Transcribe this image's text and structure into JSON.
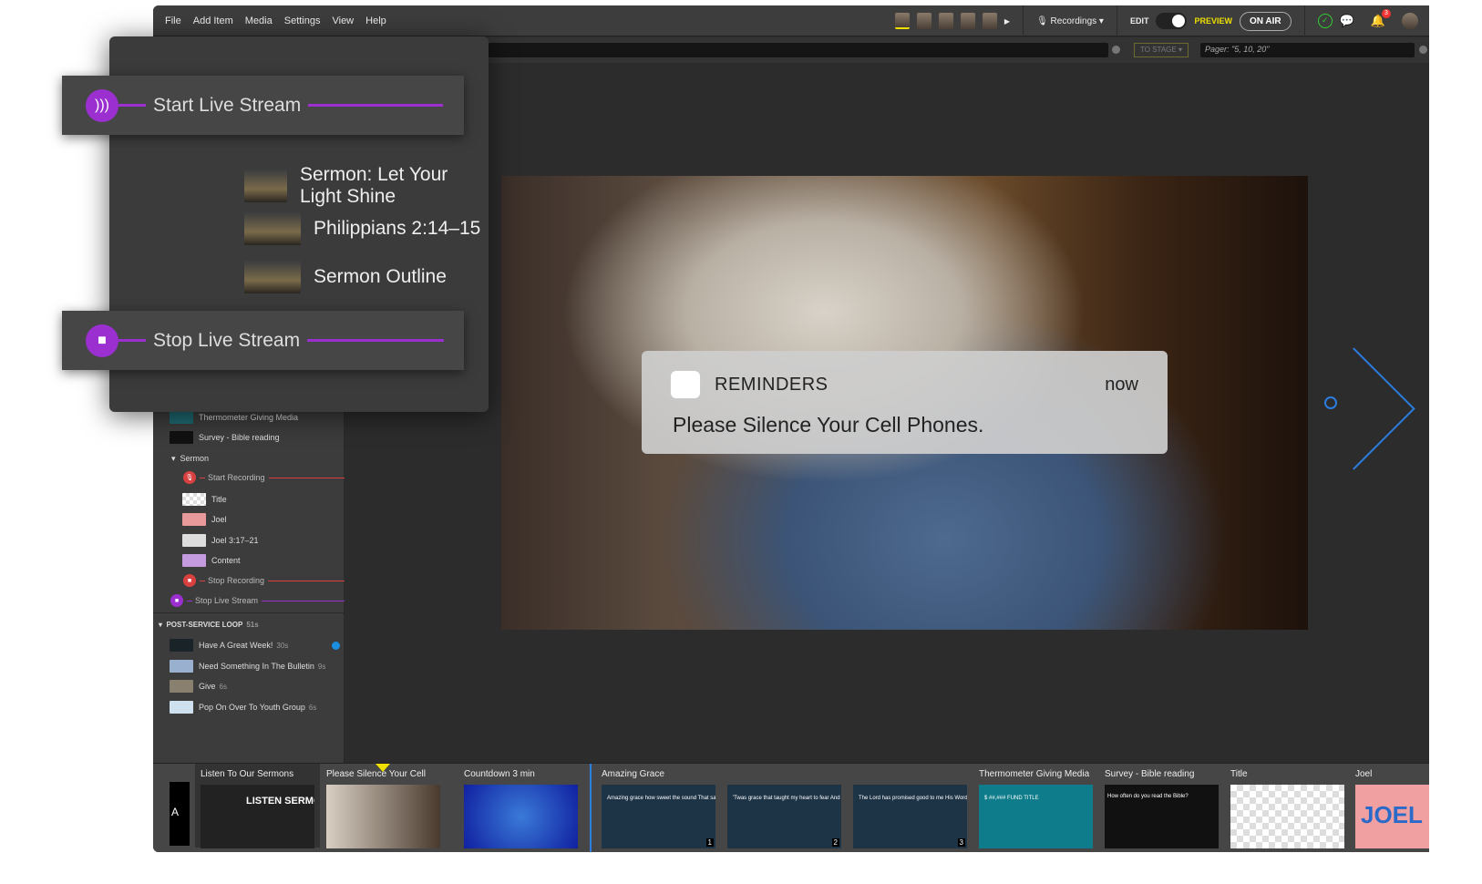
{
  "menu": [
    "File",
    "Add Item",
    "Media",
    "Settings",
    "View",
    "Help"
  ],
  "header": {
    "recordings": "Recordings",
    "edit": "EDIT",
    "preview": "PREVIEW",
    "on_air": "ON AIR",
    "notifications_count": "3",
    "accent": "#f0e000"
  },
  "toolbar": {
    "to_stage": "TO STAGE",
    "pager_placeholder": "Pager: \"5, 10, 20\""
  },
  "popup": {
    "start": "Start Live Stream",
    "stop": "Stop Live Stream",
    "items": [
      "Sermon: Let Your Light Shine",
      "Philippians 2:14–15",
      "Sermon Outline"
    ],
    "accent": "#9b2fd0"
  },
  "sidebar": {
    "items": [
      "Thermometer Giving Media",
      "Survey - Bible reading"
    ],
    "section": "Sermon",
    "start_recording": "Start Recording",
    "sermon_items": [
      "Title",
      "Joel",
      "Joel 3:17–21",
      "Content"
    ],
    "stop_recording": "Stop Recording",
    "stop_stream": "Stop Live Stream",
    "loop": {
      "title": "POST-SERVICE LOOP",
      "duration": "51s",
      "items": [
        {
          "label": "Have A Great Week!",
          "dur": "30s"
        },
        {
          "label": "Need Something In The Bulletin",
          "dur": "9s"
        },
        {
          "label": "Give",
          "dur": "6s"
        },
        {
          "label": "Pop On Over To Youth Group",
          "dur": "6s"
        }
      ]
    }
  },
  "notification": {
    "app": "REMINDERS",
    "time": "now",
    "message": "Please Silence Your Cell Phones."
  },
  "filmstrip": {
    "slides": [
      {
        "title": "Listen To Our Sermons",
        "text": "LISTEN SERMONS ONLINE"
      },
      {
        "title": "Please Silence Your Cell",
        "text": ""
      },
      {
        "title": "Countdown 3 min",
        "text": ""
      },
      {
        "title": "Amazing Grace",
        "text": "Amazing grace how sweet the sound That saved a wretch like me I once was lost but now am found Was blind but now I see",
        "num": "1"
      },
      {
        "title": "",
        "text": "'Twas grace that taught my heart to fear And grace my fears relieved How precious did that grace appear The hour I first believed",
        "num": "2"
      },
      {
        "title": "",
        "text": "The Lord has promised good to me His Word my hope secures He will my shield and portion be As long as life endures",
        "num": "3"
      },
      {
        "title": "Thermometer Giving Media",
        "text": "$ ##,### FUND TITLE"
      },
      {
        "title": "Survey - Bible reading",
        "text": "How often do you read the Bible?"
      },
      {
        "title": "Title",
        "text": ""
      },
      {
        "title": "Joel",
        "text": "JOEL"
      }
    ],
    "left_letter": "A"
  }
}
